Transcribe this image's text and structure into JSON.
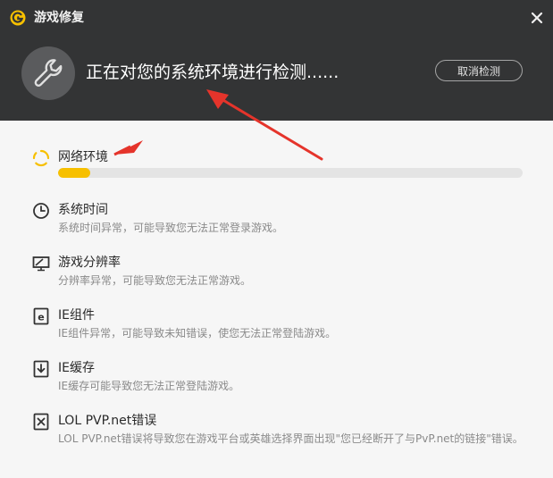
{
  "window": {
    "title": "游戏修复",
    "status_text": "正在对您的系统环境进行检测......",
    "cancel_label": "取消检测"
  },
  "colors": {
    "header_bg": "#333435",
    "accent": "#f7c000",
    "annotation": "#e5342b"
  },
  "icons": {
    "logo": "g-logo-icon",
    "close": "close-icon",
    "badge": "wrench-icon"
  },
  "network_check": {
    "label": "网络环境",
    "icon": "spinner-icon",
    "progress_fraction": 0.07
  },
  "checks": [
    {
      "label": "系统时间",
      "description": "系统时间异常，可能导致您无法正常登录游戏。",
      "icon": "clock-icon"
    },
    {
      "label": "游戏分辨率",
      "description": "分辨率异常，可能导致您无法正常游戏。",
      "icon": "monitor-icon"
    },
    {
      "label": "IE组件",
      "description": "IE组件异常，可能导致未知错误，使您无法正常登陆游戏。",
      "icon": "ie-icon"
    },
    {
      "label": "IE缓存",
      "description": "IE缓存可能导致您无法正常登陆游戏。",
      "icon": "download-icon"
    },
    {
      "label": "LOL PVP.net错误",
      "description": "LOL PVP.net错误将导致您在游戏平台或英雄选择界面出现\"您已经断开了与PvP.net的链接\"错误。",
      "icon": "broken-file-icon"
    }
  ]
}
